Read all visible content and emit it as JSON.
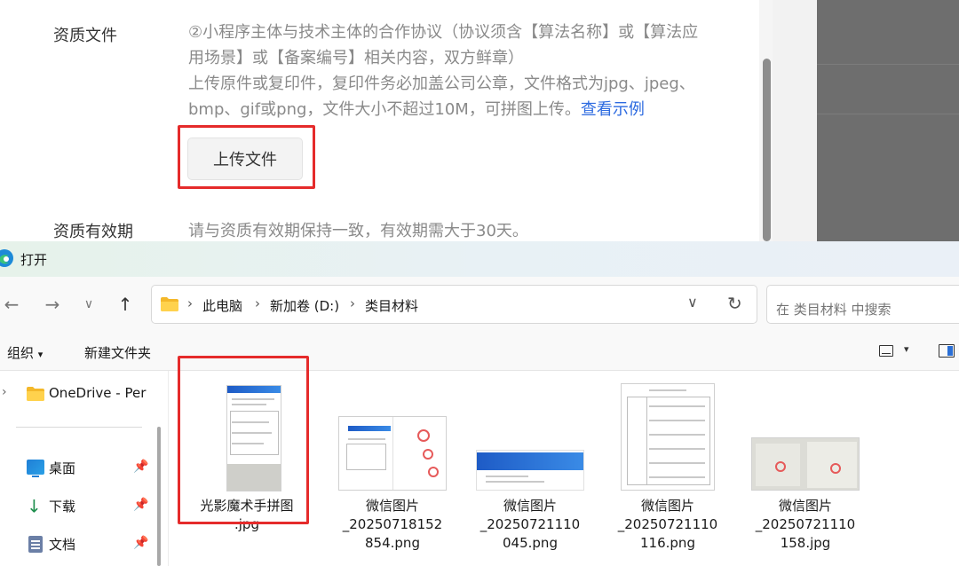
{
  "web_form": {
    "qualification_label": "资质文件",
    "qualification_desc": [
      "②小程序主体与技术主体的合作协议（协议须含【算法名称】或【算法应",
      "用场景】或【备案编号】相关内容，双方鲜章）",
      "上传原件或复印件，复印件务必加盖公司公章，文件格式为jpg、jpeg、",
      "bmp、gif或png，文件大小不超过10M，可拼图上传。"
    ],
    "example_link": "查看示例",
    "upload_button": "上传文件",
    "validity_label": "资质有效期",
    "validity_desc": "请与资质有效期保持一致，有效期需大于30天。"
  },
  "dialog": {
    "title": "打开",
    "breadcrumb": [
      "此电脑",
      "新加卷 (D:)",
      "类目材料"
    ],
    "search_placeholder": "在 类目材料 中搜索",
    "toolbar": {
      "organize": "组织",
      "organize_arrow": "▾",
      "new_folder": "新建文件夹"
    },
    "nav_icons": {
      "back": "←",
      "forward": "→",
      "recent": "∨",
      "up": "↑",
      "dropdown": "∨",
      "refresh": "↻",
      "expand": "›",
      "pin": "📌"
    },
    "nav_pane": [
      {
        "label": "OneDrive - Per",
        "icon": "folder-icon"
      },
      {
        "label": "桌面",
        "icon": "desktop-icon"
      },
      {
        "label": "下载",
        "icon": "download-icon"
      },
      {
        "label": "文档",
        "icon": "document-icon"
      }
    ],
    "files": [
      {
        "name_lines": [
          "光影魔术手拼图",
          ".jpg"
        ]
      },
      {
        "name_lines": [
          "微信图片",
          "_20250718152",
          "854.png"
        ]
      },
      {
        "name_lines": [
          "微信图片",
          "_20250721110",
          "045.png"
        ]
      },
      {
        "name_lines": [
          "微信图片",
          "_20250721110",
          "116.png"
        ]
      },
      {
        "name_lines": [
          "微信图片",
          "_20250721110",
          "158.jpg"
        ]
      }
    ]
  },
  "colors": {
    "highlight": "#e52b2b",
    "link": "#2d6be0",
    "accent_blue": "#2a6fd6"
  }
}
